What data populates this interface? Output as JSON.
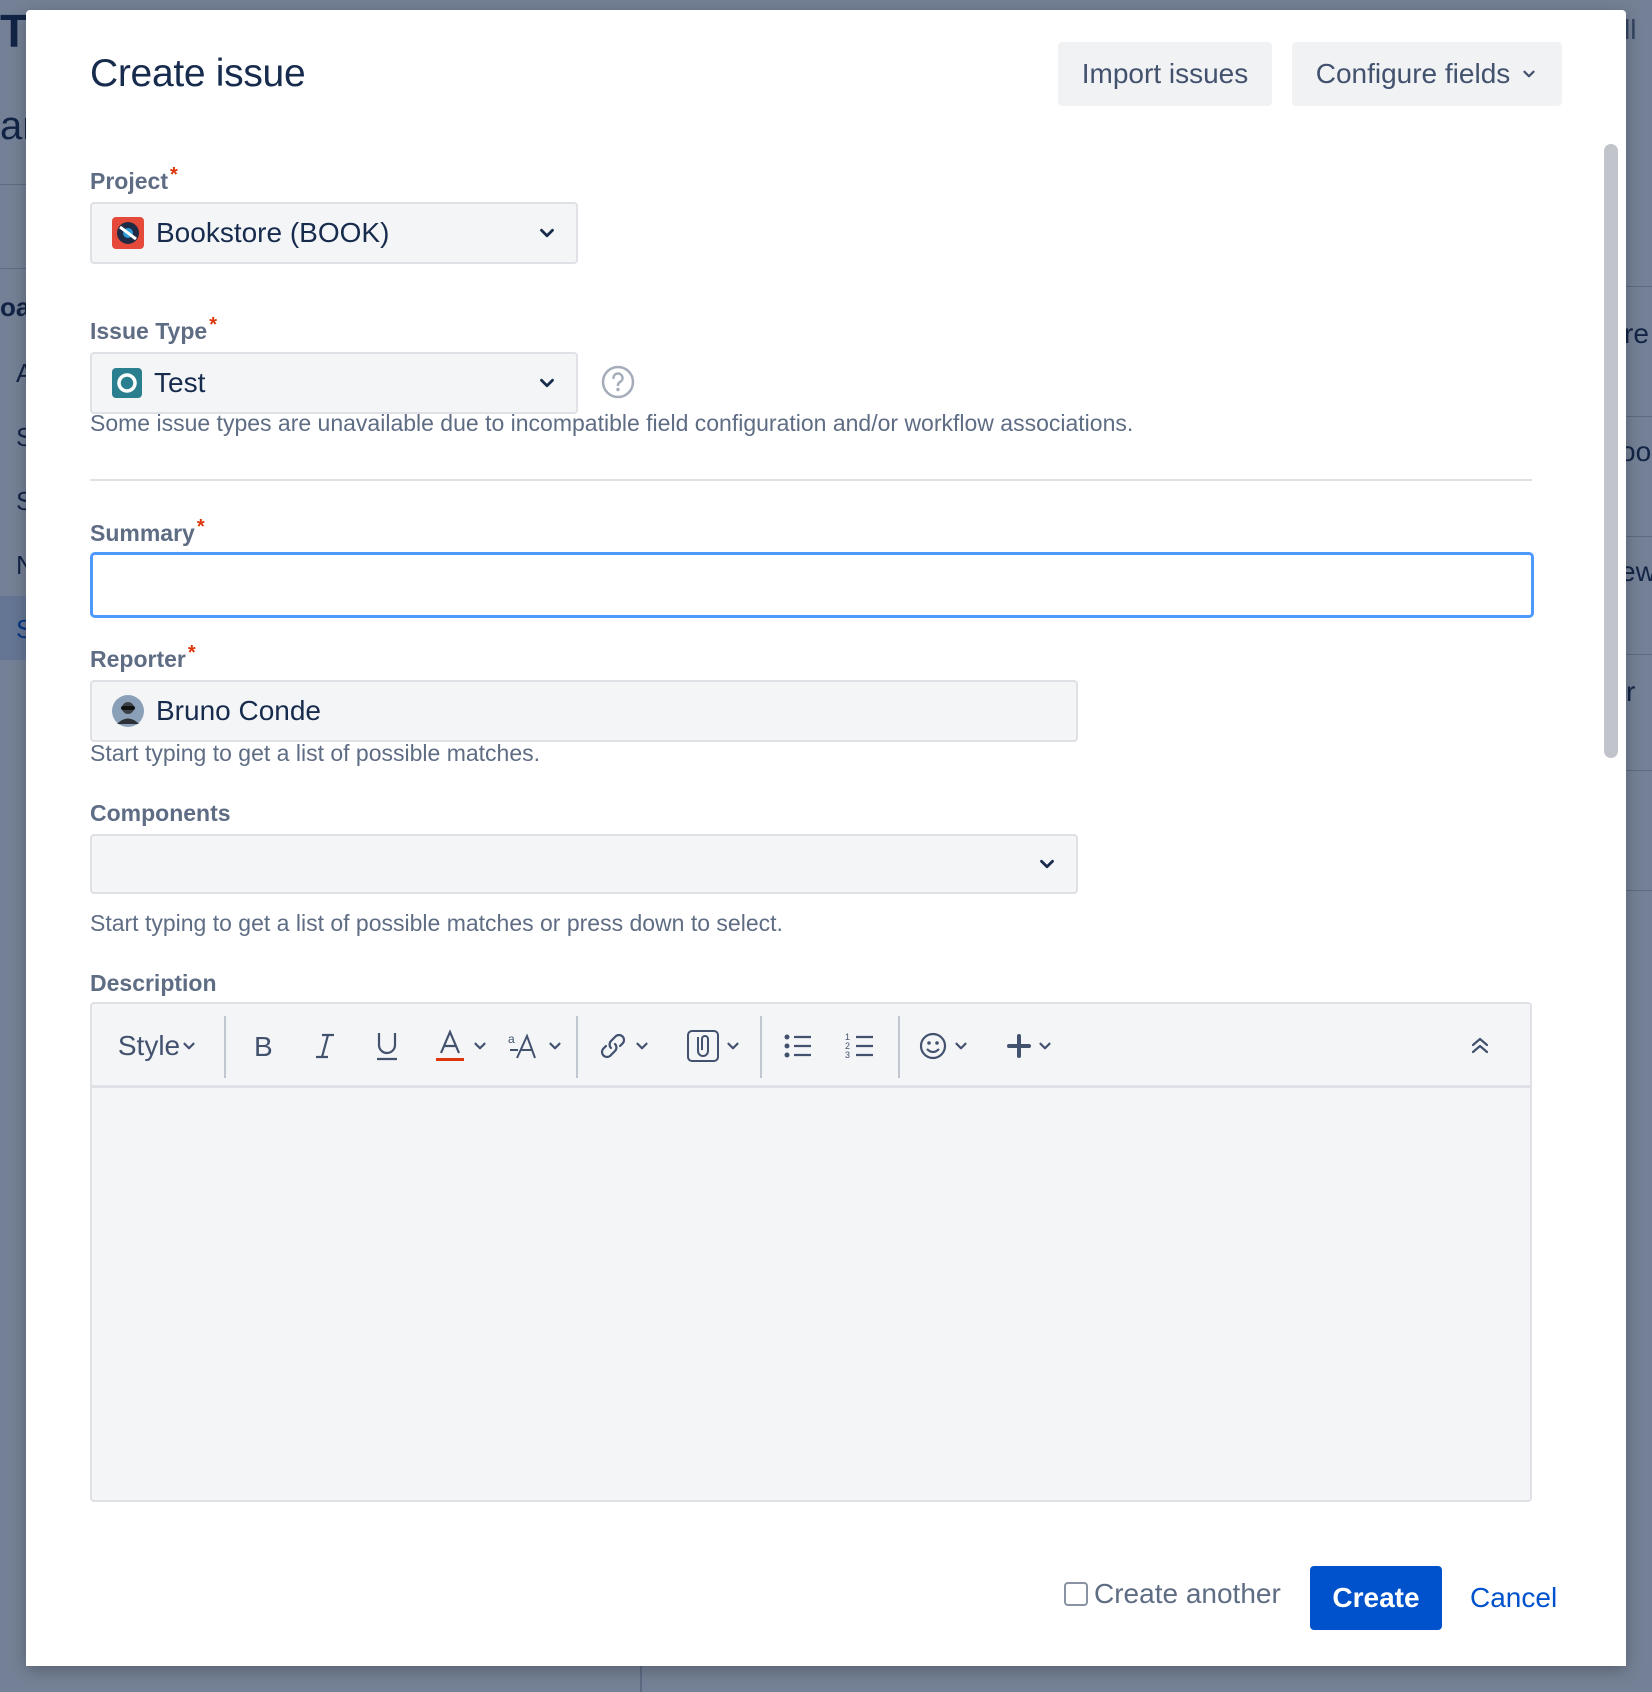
{
  "modal": {
    "title": "Create issue",
    "import_label": "Import issues",
    "configure_label": "Configure fields"
  },
  "fields": {
    "project": {
      "label": "Project",
      "required_mark": "*",
      "value": "Bookstore (BOOK)"
    },
    "issue_type": {
      "label": "Issue Type",
      "required_mark": "*",
      "value": "Test",
      "help": "Some issue types are unavailable due to incompatible field configuration and/or workflow associations."
    },
    "summary": {
      "label": "Summary",
      "required_mark": "*",
      "value": ""
    },
    "reporter": {
      "label": "Reporter",
      "required_mark": "*",
      "value": "Bruno Conde",
      "help": "Start typing to get a list of possible matches."
    },
    "components": {
      "label": "Components",
      "value": "",
      "help": "Start typing to get a list of possible matches or press down to select."
    },
    "description": {
      "label": "Description",
      "style_label": "Style"
    }
  },
  "footer": {
    "create_another_label": "Create another",
    "create_another_checked": false,
    "create_label": "Create",
    "cancel_label": "Cancel"
  },
  "colors": {
    "primary": "#0052cc",
    "focus_border": "#4c9aff",
    "required": "#de350b",
    "text_color_underline": "#de350b",
    "project_icon": "#e5493a",
    "test_icon": "#2a7f8e"
  },
  "icons": [
    "project-avatar-icon",
    "test-issue-type-icon",
    "chevron-down-icon",
    "help-circle-icon",
    "user-avatar",
    "bold-icon",
    "italic-icon",
    "underline-icon",
    "text-color-icon",
    "text-effects-icon",
    "link-icon",
    "attachment-icon",
    "bullet-list-icon",
    "numbered-list-icon",
    "emoji-icon",
    "plus-icon",
    "collapse-toolbar-icon"
  ],
  "background_fragments": {
    "t1": "Te",
    "t2": "an",
    "t3": "oa",
    "t4": "A",
    "t5": "S",
    "t6": "S",
    "t7": "N",
    "t8": "S",
    "r1": "ll",
    "r2": "re",
    "r3": "oo",
    "r4": "ew",
    "r5": "r"
  }
}
